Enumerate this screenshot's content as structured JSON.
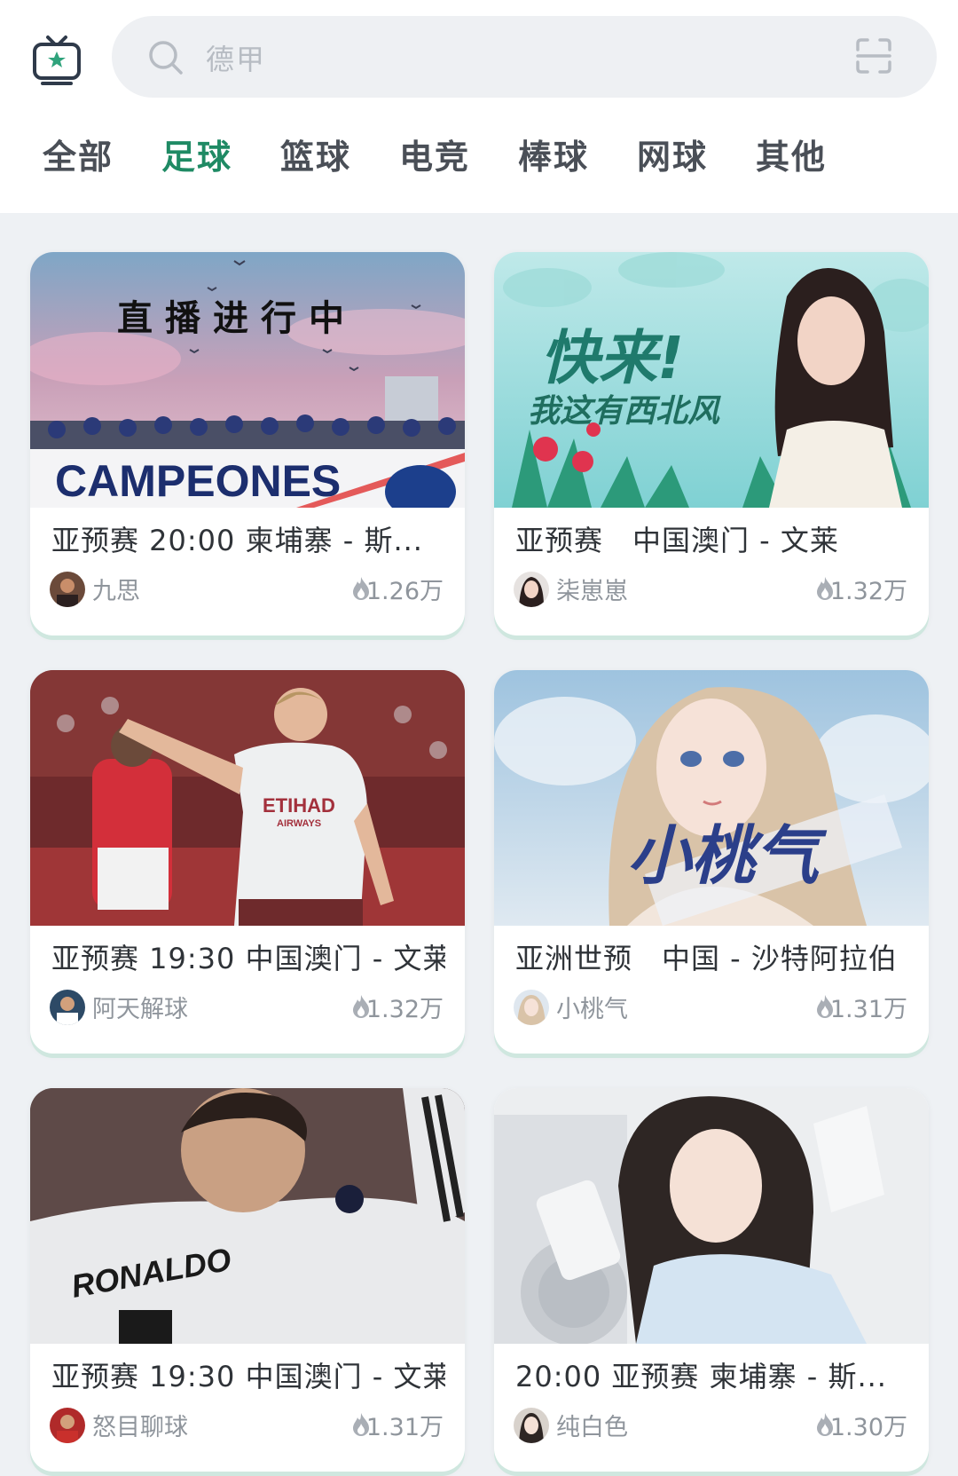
{
  "search": {
    "placeholder": "德甲"
  },
  "tabs": [
    "全部",
    "足球",
    "篮球",
    "电竞",
    "棒球",
    "网球",
    "其他"
  ],
  "active_tab": "足球",
  "cards": [
    {
      "title": "亚预赛 20:00 柬埔寨 - 斯...",
      "streamer": "九思",
      "views": "1.26万",
      "overlay": "直播进行中",
      "banner": "CAMPEONES"
    },
    {
      "title": "亚预赛　中国澳门 - 文莱",
      "streamer": "柒崽崽",
      "views": "1.32万",
      "overlay": "快来!",
      "overlay2": "我这有西北风"
    },
    {
      "title": "亚预赛 19:30 中国澳门 - 文莱",
      "streamer": "阿天解球",
      "views": "1.32万",
      "shirt": "ETIHAD",
      "shirt2": "AIRWAYS"
    },
    {
      "title": "亚洲世预　中国 - 沙特阿拉伯",
      "streamer": "小桃气",
      "views": "1.31万",
      "overlay": "小桃气"
    },
    {
      "title": "亚预赛 19:30 中国澳门 - 文莱",
      "streamer": "怒目聊球",
      "views": "1.31万",
      "shirt": "RONALDO"
    },
    {
      "title": "20:00 亚预赛 柬埔寨 - 斯...",
      "streamer": "纯白色",
      "views": "1.30万"
    }
  ],
  "colors": {
    "accent": "#1f8a64",
    "background": "#eef1f4"
  }
}
